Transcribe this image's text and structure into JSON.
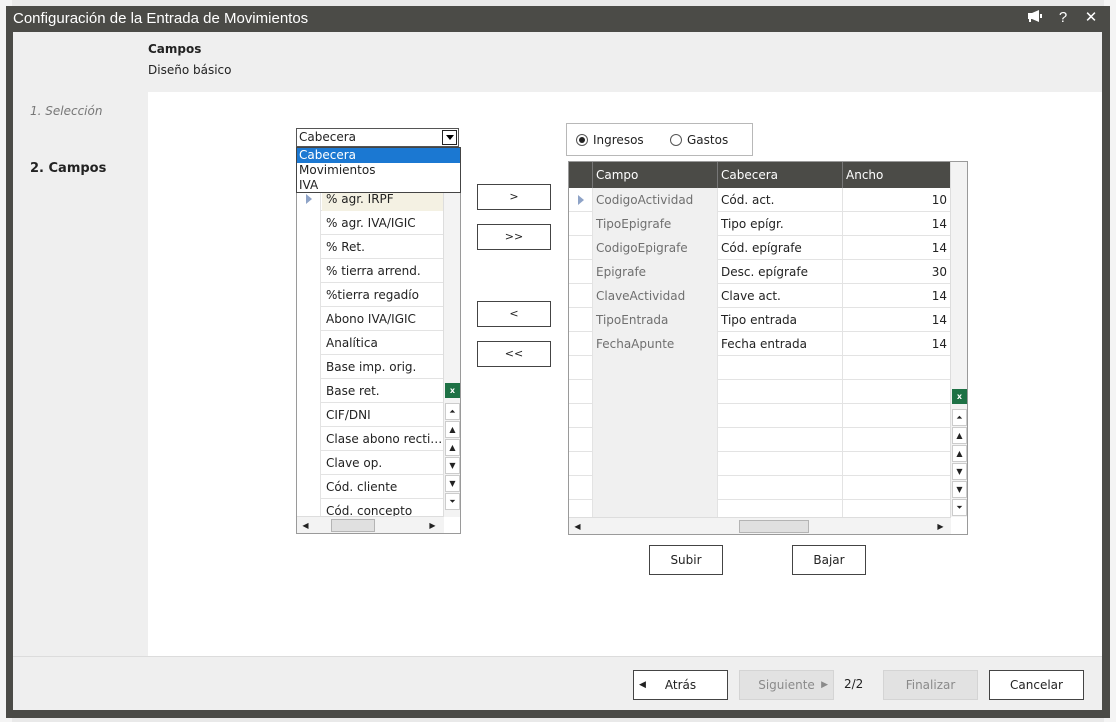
{
  "window": {
    "title": "Configuración de la Entrada de Movimientos"
  },
  "titlebar_icons": [
    "megaphone-icon",
    "help-icon",
    "close-icon"
  ],
  "titlebar_help": "?",
  "titlebar_close": "✕",
  "header": {
    "title": "Campos",
    "subtitle": "Diseño básico"
  },
  "steps": [
    {
      "label": "1. Selección",
      "active": false
    },
    {
      "label": "2. Campos",
      "active": true
    }
  ],
  "combo": {
    "value": "Cabecera",
    "options": [
      "Cabecera",
      "Movimientos",
      "IVA"
    ],
    "selected_index": 0
  },
  "available_fields": [
    "% agr. IRPF",
    "% agr. IVA/IGIC",
    "% Ret.",
    "% tierra arrend.",
    "%tierra regadío",
    "Abono IVA/IGIC",
    "Analítica",
    "Base imp. orig.",
    "Base ret.",
    "CIF/DNI",
    "Clase abono rectificativa",
    "Clave op.",
    "Cód. cliente",
    "Cód. concepto"
  ],
  "move_buttons": {
    "add": ">",
    "add_all": ">>",
    "remove": "<",
    "remove_all": "<<"
  },
  "radio": {
    "options": [
      "Ingresos",
      "Gastos"
    ],
    "selected": "Ingresos"
  },
  "selected_fields": {
    "columns": [
      "Campo",
      "Cabecera",
      "Ancho"
    ],
    "rows": [
      [
        "CodigoActividad",
        "Cód. act.",
        "10"
      ],
      [
        "TipoEpigrafe",
        "Tipo epígr.",
        "14"
      ],
      [
        "CodigoEpigrafe",
        "Cód. epígrafe",
        "14"
      ],
      [
        "Epigrafe",
        "Desc. epígrafe",
        "30"
      ],
      [
        "ClaveActividad",
        "Clave act.",
        "14"
      ],
      [
        "TipoEntrada",
        "Tipo entrada",
        "14"
      ],
      [
        "FechaApunte",
        "Fecha entrada",
        "14"
      ]
    ]
  },
  "order_buttons": {
    "up": "Subir",
    "down": "Bajar"
  },
  "footer": {
    "back": "Atrás",
    "next": "Siguiente",
    "page": "2/2",
    "finish": "Finalizar",
    "cancel": "Cancelar"
  },
  "excel_icon_label": "x"
}
